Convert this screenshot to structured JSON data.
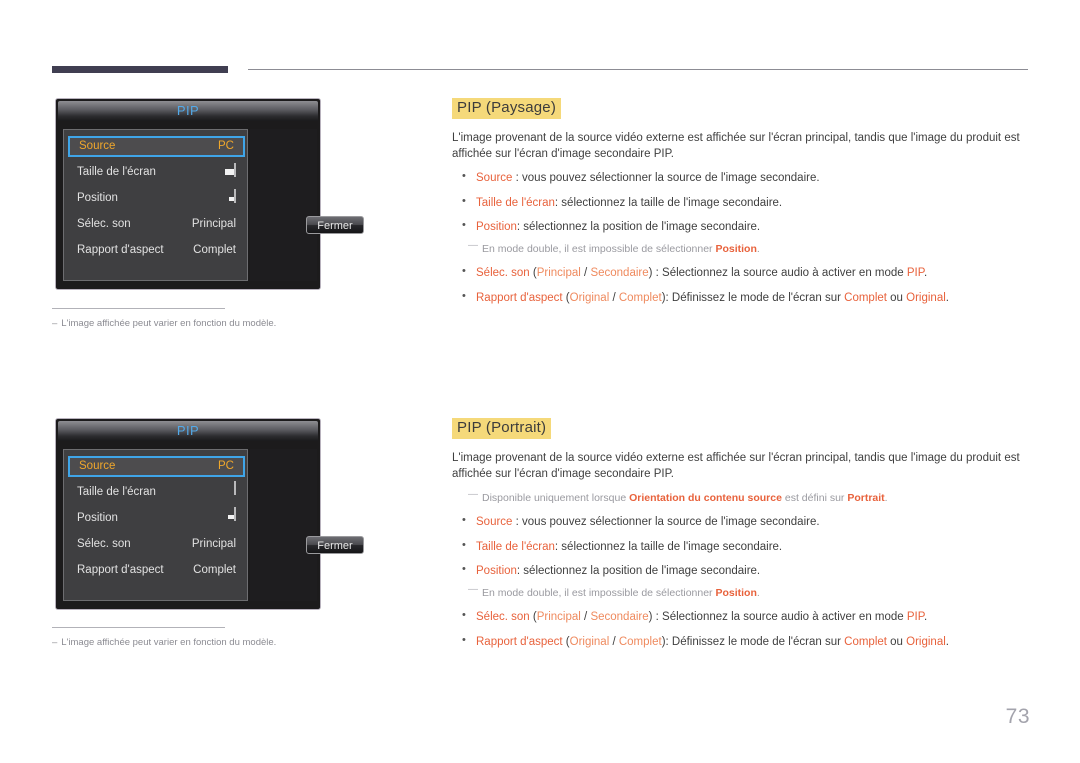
{
  "page": {
    "number": "73",
    "accent_highlight": "#f5d97a",
    "accent_keyword": "#e8623c",
    "header_tab_color": "#403e51"
  },
  "osd_panels": [
    {
      "title": "PIP",
      "orientation": "landscape",
      "rows": [
        {
          "label": "Source",
          "value": "PC",
          "selected": true,
          "icon": null
        },
        {
          "label": "Taille de l'écran",
          "value": "",
          "selected": false,
          "icon": "screen-size-landscape-icon"
        },
        {
          "label": "Position",
          "value": "",
          "selected": false,
          "icon": "position-landscape-icon"
        },
        {
          "label": "Sélec. son",
          "value": "Principal",
          "selected": false,
          "icon": null
        },
        {
          "label": "Rapport d'aspect",
          "value": "Complet",
          "selected": false,
          "icon": null
        }
      ],
      "close_button": "Fermer",
      "footnote": "L'image affichée peut varier en fonction du modèle.",
      "footnote_dash": "–"
    },
    {
      "title": "PIP",
      "orientation": "portrait",
      "rows": [
        {
          "label": "Source",
          "value": "PC",
          "selected": true,
          "icon": null
        },
        {
          "label": "Taille de l'écran",
          "value": "",
          "selected": false,
          "icon": "screen-size-portrait-icon"
        },
        {
          "label": "Position",
          "value": "",
          "selected": false,
          "icon": "position-portrait-icon"
        },
        {
          "label": "Sélec. son",
          "value": "Principal",
          "selected": false,
          "icon": null
        },
        {
          "label": "Rapport d'aspect",
          "value": "Complet",
          "selected": false,
          "icon": null
        }
      ],
      "close_button": "Fermer",
      "footnote": "L'image affichée peut varier en fonction du modèle.",
      "footnote_dash": "–"
    }
  ],
  "sections": [
    {
      "title": "PIP (Paysage)",
      "paragraph": "L'image provenant de la source vidéo externe est affichée sur l'écran principal, tandis que l'image du produit est affichée sur l'écran d'image secondaire PIP.",
      "bullets": {
        "b1_key": "Source",
        "b1_rest": " : vous pouvez sélectionner la source de l'image secondaire.",
        "b2_key": "Taille de l'écran",
        "b2_rest": ": sélectionnez la taille de l'image secondaire.",
        "b3_key": "Position",
        "b3_rest": ": sélectionnez la position de l'image secondaire.",
        "note1_a": "En mode double, il est impossible de sélectionner ",
        "note1_key": "Position",
        "note1_b": ".",
        "b4_key": "Sélec. son",
        "b4_p1": " (",
        "b4_opt1": "Principal",
        "b4_sep": " / ",
        "b4_opt2": "Secondaire",
        "b4_p2": ") : Sélectionnez la source audio à activer en mode ",
        "b4_key2": "PIP",
        "b4_p3": ".",
        "b5_key": "Rapport d'aspect",
        "b5_p1": " (",
        "b5_opt1": "Original",
        "b5_sep": " / ",
        "b5_opt2": "Complet",
        "b5_p2": "): Définissez le mode de l'écran sur ",
        "b5_key2": "Complet",
        "b5_p3": " ou ",
        "b5_key3": "Original",
        "b5_p4": "."
      }
    },
    {
      "title": "PIP (Portrait)",
      "paragraph": "L'image provenant de la source vidéo externe est affichée sur l'écran principal, tandis que l'image du produit est affichée sur l'écran d'image secondaire PIP.",
      "top_note": {
        "a": "Disponible uniquement lorsque ",
        "key": "Orientation du contenu source",
        "b": " est défini sur ",
        "key2": "Portrait",
        "c": "."
      },
      "bullets": {
        "b1_key": "Source",
        "b1_rest": " : vous pouvez sélectionner la source de l'image secondaire.",
        "b2_key": "Taille de l'écran",
        "b2_rest": ": sélectionnez la taille de l'image secondaire.",
        "b3_key": "Position",
        "b3_rest": ": sélectionnez la position de l'image secondaire.",
        "note1_a": "En mode double, il est impossible de sélectionner ",
        "note1_key": "Position",
        "note1_b": ".",
        "b4_key": "Sélec. son",
        "b4_p1": " (",
        "b4_opt1": "Principal",
        "b4_sep": " / ",
        "b4_opt2": "Secondaire",
        "b4_p2": ") : Sélectionnez la source audio à activer en mode ",
        "b4_key2": "PIP",
        "b4_p3": ".",
        "b5_key": "Rapport d'aspect",
        "b5_p1": " (",
        "b5_opt1": "Original",
        "b5_sep": " / ",
        "b5_opt2": "Complet",
        "b5_p2": "): Définissez le mode de l'écran sur ",
        "b5_key2": "Complet",
        "b5_p3": " ou ",
        "b5_key3": "Original",
        "b5_p4": "."
      }
    }
  ]
}
